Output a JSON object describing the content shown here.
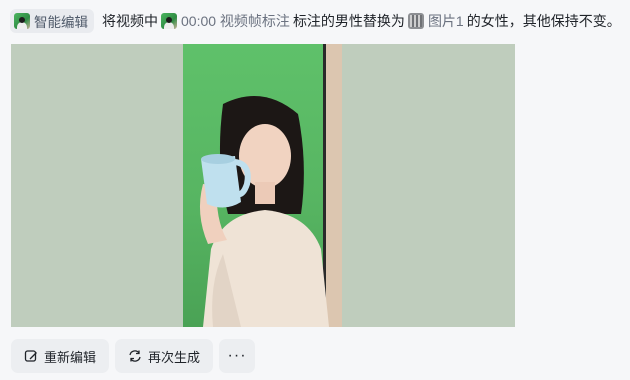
{
  "prompt": {
    "mode_label": "智能编辑",
    "part1": "将视频中",
    "video_ref": "00:00 视频帧标注",
    "part2": "标注的男性替换为",
    "image_ref": "图片1",
    "part3": "的女性，其他保持不变。"
  },
  "actions": {
    "reedit_label": "重新编辑",
    "regenerate_label": "再次生成",
    "more_label": "···"
  },
  "colors": {
    "page_bg": "#f6f7f9",
    "side_panel": "#bfcdbd",
    "green_screen": "#5fc16a",
    "button_bg": "#eceef1"
  }
}
